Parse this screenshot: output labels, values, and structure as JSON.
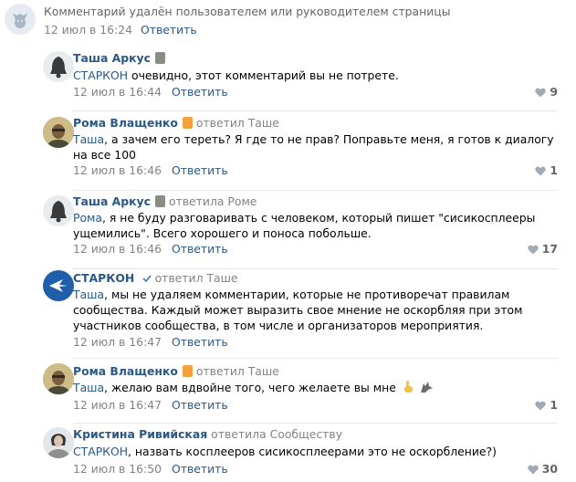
{
  "deleted": {
    "text": "Комментарий удалён пользователем или руководителем страницы",
    "time": "12 июл в 16:24",
    "reply": "Ответить"
  },
  "comments": [
    {
      "author": "Таша Аркус",
      "reply_to": "",
      "mention": "СТАРКОН",
      "text": " очевидно, этот комментарий вы не потрете.",
      "time": "12 июл в 16:44",
      "reply": "Ответить",
      "likes": "9"
    },
    {
      "author": "Рома Влащенко",
      "reply_to": "ответил Таше",
      "mention": "Таша",
      "text": ", а зачем его тереть? Я где то не прав? Поправьте меня, я готов к диалогу на все 100",
      "time": "12 июл в 16:46",
      "reply": "Ответить",
      "likes": "1"
    },
    {
      "author": "Таша Аркус",
      "reply_to": "ответила Роме",
      "mention": "Рома",
      "text": ", я не буду разговаривать с человеком, который пишет \"сисикосплееры ущемились\". Всего хорошего и поноса побольше.",
      "time": "12 июл в 16:46",
      "reply": "Ответить",
      "likes": "17"
    },
    {
      "author": "СТАРКОН",
      "reply_to": "ответил Таше",
      "mention": "Таша",
      "text": ", мы не удаляем комментарии, которые не противоречат правилам сообщества. Каждый может выразить свое мнение не оскорбляя при этом участников сообщества, в том числе и организаторов мероприятия.",
      "time": "12 июл в 16:47",
      "reply": "Ответить",
      "likes": ""
    },
    {
      "author": "Рома Влащенко",
      "reply_to": "ответил Таше",
      "mention": "Таша",
      "text": ", желаю вам вдвойне того, чего желаете вы мне",
      "time": "12 июл в 16:47",
      "reply": "Ответить",
      "likes": "1"
    },
    {
      "author": "Кристина Ривийская",
      "reply_to": "ответила Сообществу",
      "mention": "СТАРКОН",
      "text": ", назвать косплееров сисикосплеерами это не оскорбление?)",
      "time": "12 июл в 16:50",
      "reply": "Ответить",
      "likes": "30"
    }
  ],
  "colors": {
    "link": "#2a5885",
    "muted": "#828282",
    "like": "#a0a9b5",
    "verified": "#5181b8"
  },
  "icons": [
    "vk-dog-avatar-icon",
    "bell-avatar-icon",
    "heart-icon",
    "verified-check-icon",
    "point-up-hand-icon",
    "wolf-icon"
  ]
}
